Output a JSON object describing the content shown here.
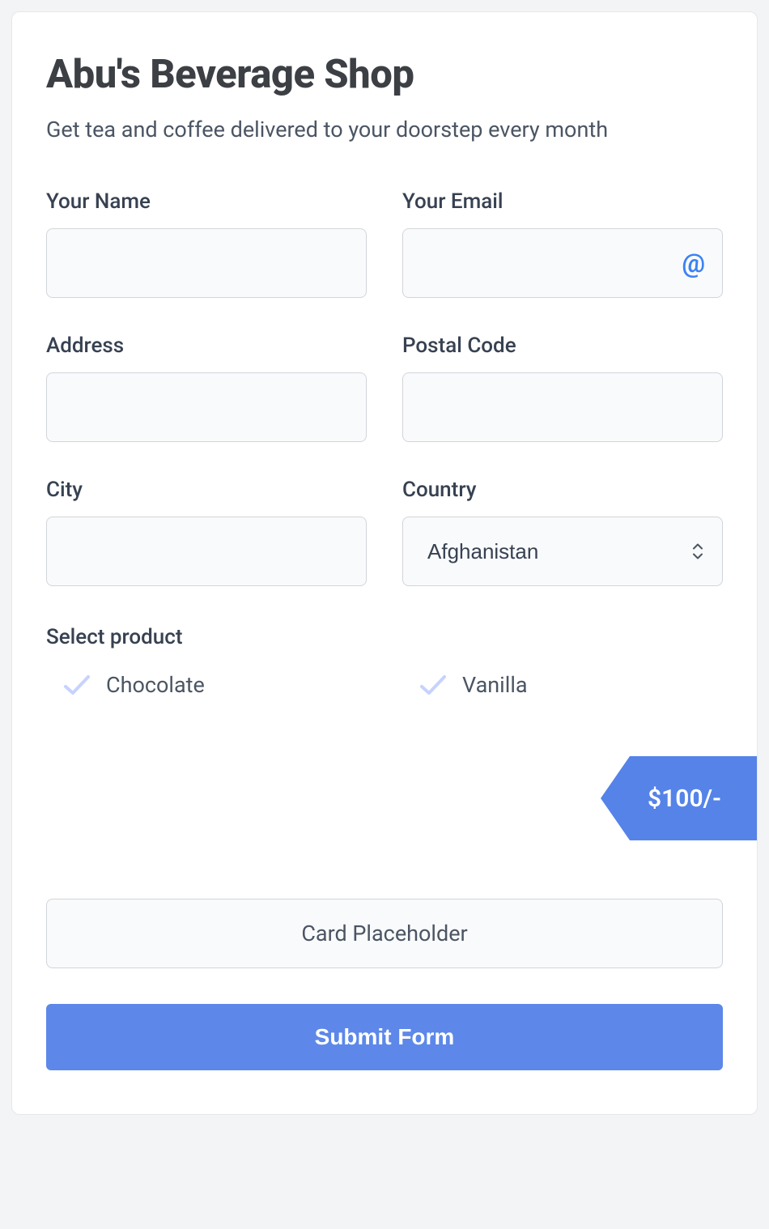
{
  "header": {
    "title": "Abu's Beverage Shop",
    "subtitle": "Get tea and coffee delivered to your doorstep every month"
  },
  "form": {
    "name": {
      "label": "Your Name",
      "value": ""
    },
    "email": {
      "label": "Your Email",
      "value": ""
    },
    "address": {
      "label": "Address",
      "value": ""
    },
    "postal": {
      "label": "Postal Code",
      "value": ""
    },
    "city": {
      "label": "City",
      "value": ""
    },
    "country": {
      "label": "Country",
      "selected": "Afghanistan"
    }
  },
  "products": {
    "label": "Select product",
    "options": [
      {
        "label": "Chocolate"
      },
      {
        "label": "Vanilla"
      }
    ]
  },
  "price": {
    "display": "$100/-"
  },
  "card": {
    "placeholder": "Card Placeholder"
  },
  "submit": {
    "label": "Submit Form"
  }
}
